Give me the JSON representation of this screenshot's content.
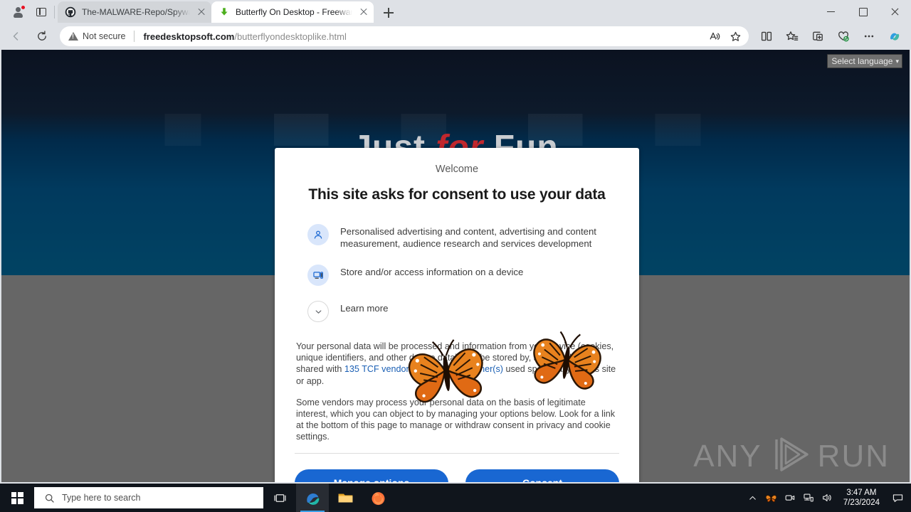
{
  "browser": {
    "name": "Microsoft Edge",
    "tabs": [
      {
        "title": "The-MALWARE-Repo/Spyware/b",
        "favicon": "github-icon",
        "active": false
      },
      {
        "title": "Butterfly On Desktop - Freeware",
        "favicon": "download-arrow-icon",
        "active": true
      }
    ],
    "new_tab_label": "New tab",
    "window_controls": {
      "minimize": "Minimize",
      "maximize": "Maximize",
      "close": "Close"
    },
    "toolbar": {
      "back": "Back",
      "refresh": "Refresh",
      "security_label": "Not secure",
      "url_domain": "freedesktopsoft.com",
      "url_path": "/butterflyondesktoplike.html",
      "icons": [
        "read-aloud-icon",
        "favorite-star-icon",
        "split-screen-icon",
        "favorites-list-icon",
        "collections-icon",
        "browser-essentials-icon",
        "settings-more-icon",
        "copilot-icon"
      ]
    }
  },
  "page": {
    "hero_title_part1": "Just ",
    "hero_title_accent": "for",
    "hero_title_part2": " Fun",
    "language_select": "Select language",
    "language_chevron": "▾"
  },
  "consent": {
    "welcome": "Welcome",
    "heading": "This site asks for consent to use your data",
    "purposes": [
      {
        "icon": "person-icon",
        "text": "Personalised advertising and content, advertising and content measurement, audience research and services development"
      },
      {
        "icon": "device-icon",
        "text": "Store and/or access information on a device"
      },
      {
        "icon": "chevron-down-icon",
        "text": "Learn more"
      }
    ],
    "paragraph1_before": "Your personal data will be processed and information from your device (cookies, unique identifiers, and other device data) may be stored by, accessed by and shared with ",
    "paragraph1_link": "135 TCF vendor(s) and 63 ad partner(s)",
    "paragraph1_after": " used specifically by this site or app.",
    "paragraph2": "Some vendors may process your personal data on the basis of legitimate interest, which you can object to by managing your options below. Look for a link at the bottom of this page to manage or withdraw consent in privacy and cookie settings.",
    "manage_button": "Manage options",
    "consent_button": "Consent",
    "accent_color": "#1967d2"
  },
  "watermark": {
    "word1": "ANY",
    "word2": "RUN",
    "logo": "play-triangle-icon"
  },
  "taskbar": {
    "start": "Start",
    "search_placeholder": "Type here to search",
    "task_view": "Task View",
    "pinned": [
      {
        "name": "Microsoft Edge",
        "active": true
      },
      {
        "name": "File Explorer",
        "active": false
      },
      {
        "name": "Mozilla Firefox",
        "active": false
      }
    ],
    "tray": [
      "show-hidden-icons-icon",
      "butterfly-tray-icon",
      "camera-icon",
      "network-icon",
      "volume-icon"
    ],
    "time": "3:47 AM",
    "date": "7/23/2024",
    "action_center": "action-center-icon"
  }
}
